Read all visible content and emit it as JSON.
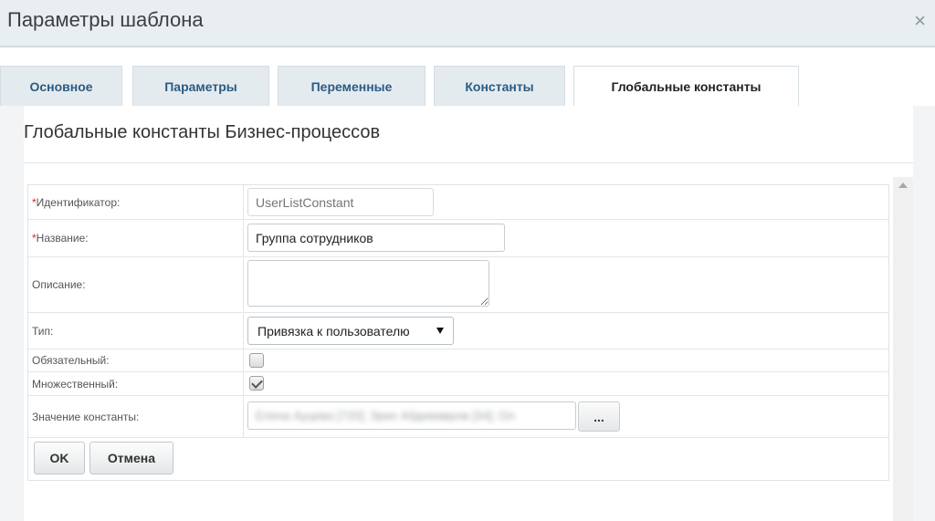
{
  "window": {
    "title": "Параметры шаблона",
    "close_glyph": "×"
  },
  "tabs": [
    {
      "label": "Основное",
      "active": false
    },
    {
      "label": "Параметры",
      "active": false
    },
    {
      "label": "Переменные",
      "active": false
    },
    {
      "label": "Константы",
      "active": false
    },
    {
      "label": "Глобальные константы",
      "active": true
    }
  ],
  "section": {
    "title": "Глобальные константы Бизнес-процессов"
  },
  "form": {
    "required_mark": "*",
    "id_label": "Идентификатор:",
    "id_placeholder": "UserListConstant",
    "name_label": "Название:",
    "name_value": "Группа сотрудников",
    "description_label": "Описание:",
    "description_value": "",
    "type_label": "Тип:",
    "type_value": "Привязка к пользователю",
    "required_label": "Обязательный:",
    "required_checked": false,
    "multiple_label": "Множественный:",
    "multiple_checked": true,
    "value_label": "Значение константы:",
    "value_text": "Елена Ауцева [720]; Эрих Абдимавров [34]; Ол",
    "browse_label": "..."
  },
  "buttons": {
    "ok": "OK",
    "cancel": "Отмена"
  },
  "colors": {
    "tab_text": "#2a5b83",
    "required": "#d9232e",
    "titlebar_bg": "#e9eef1"
  }
}
